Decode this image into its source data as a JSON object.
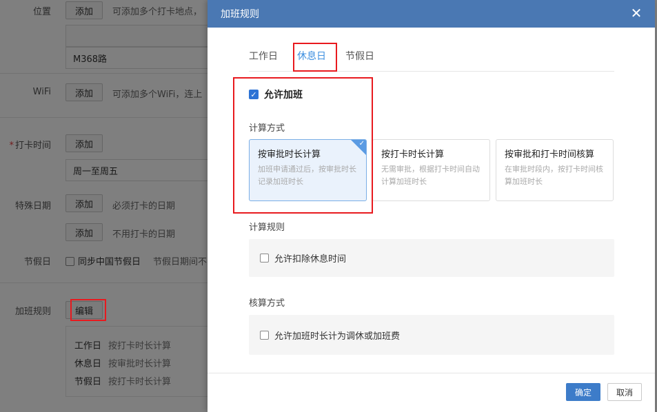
{
  "background": {
    "location": {
      "label": "位置",
      "add_button": "添加",
      "hint": "可添加多个打卡地点，",
      "value": "M368路"
    },
    "wifi": {
      "label": "WiFi",
      "add_button": "添加",
      "hint": "可添加多个WiFi，连上"
    },
    "checkin_time": {
      "required_mark": "*",
      "label": "打卡时间",
      "add_button": "添加",
      "value": "周一至周五"
    },
    "special_dates": {
      "label": "特殊日期",
      "add_button_1": "添加",
      "hint_1": "必须打卡的日期",
      "add_button_2": "添加",
      "hint_2": "不用打卡的日期"
    },
    "holiday": {
      "label": "节假日",
      "checkbox_label": "同步中国节假日",
      "hint": "节假日期间不"
    },
    "overtime_rules": {
      "label": "加班规则",
      "edit_button": "编辑",
      "summary": [
        {
          "day": "工作日",
          "method": "按打卡时长计算"
        },
        {
          "day": "休息日",
          "method": "按审批时长计算"
        },
        {
          "day": "节假日",
          "method": "按打卡时长计算"
        }
      ]
    }
  },
  "modal": {
    "title": "加班规则",
    "tabs": [
      {
        "label": "工作日",
        "active": false
      },
      {
        "label": "休息日",
        "active": true
      },
      {
        "label": "节假日",
        "active": false
      }
    ],
    "allow_overtime": {
      "label": "允许加班",
      "checked": true
    },
    "calc_method": {
      "label": "计算方式",
      "options": [
        {
          "title": "按审批时长计算",
          "desc": "加班申请通过后，按审批时长记录加班时长",
          "selected": true
        },
        {
          "title": "按打卡时长计算",
          "desc": "无需审批，根据打卡时间自动计算加班时长",
          "selected": false
        },
        {
          "title": "按审批和打卡时间核算",
          "desc": "在审批时段内，按打卡时间核算加班时长",
          "selected": false
        }
      ]
    },
    "calc_rule": {
      "label": "计算规则",
      "option": "允许扣除休息时间",
      "checked": false
    },
    "settle_method": {
      "label": "核算方式",
      "option": "允许加班时长计为调休或加班费",
      "checked": false
    },
    "footer": {
      "ok": "确定",
      "cancel": "取消"
    }
  },
  "colors": {
    "header": "#4a78b3",
    "accent": "#3d8fe0",
    "highlight": "#e8191e"
  }
}
